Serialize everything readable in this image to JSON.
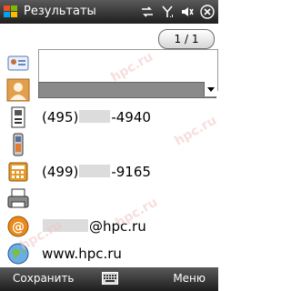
{
  "window": {
    "title": "Результаты"
  },
  "pager": {
    "label": "1 / 1"
  },
  "contact": {
    "name": "",
    "category": "",
    "phone1": {
      "prefix": "(495)",
      "suffix": "-4940"
    },
    "phone2": {
      "value": ""
    },
    "phone3": {
      "prefix": "(499)",
      "suffix": "-9165"
    },
    "fax": {
      "value": ""
    },
    "email": {
      "suffix": "@hpc.ru"
    },
    "website": {
      "value": "www.hpc.ru"
    }
  },
  "softkeys": {
    "left": "Сохранить",
    "right": "Меню"
  },
  "watermark": "hpc.ru",
  "icons": [
    "windows-logo-icon",
    "sync-icon",
    "signal-icon",
    "volume-icon",
    "close-icon",
    "business-card-icon",
    "person-icon",
    "work-phone-icon",
    "mobile-phone-icon",
    "desk-phone-icon",
    "fax-icon",
    "email-icon",
    "web-icon",
    "keyboard-icon"
  ]
}
